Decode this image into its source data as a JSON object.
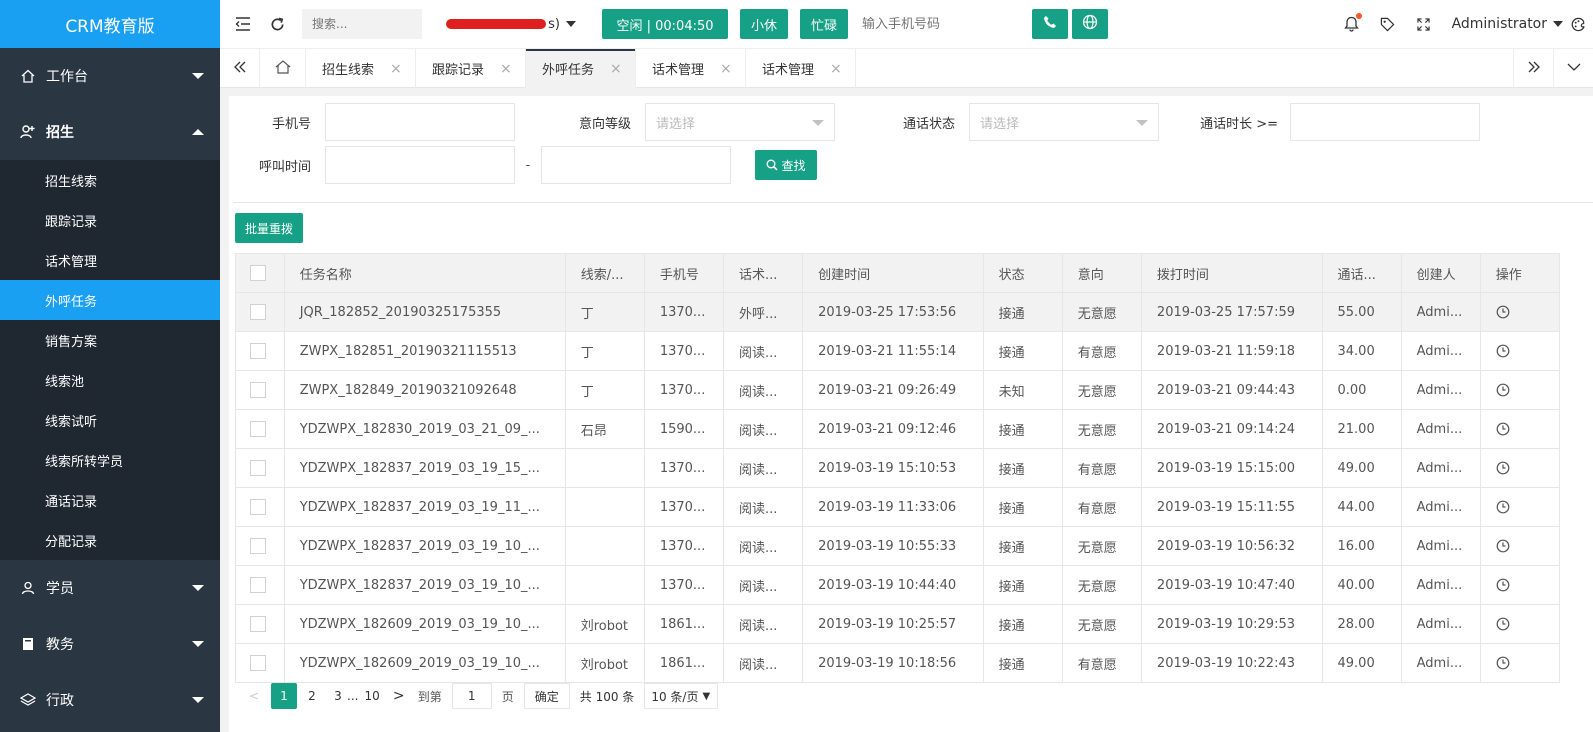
{
  "app": {
    "title": "CRM教育版"
  },
  "sidebar": {
    "items": [
      {
        "label": "工作台"
      },
      {
        "label": "招生"
      },
      {
        "label": "学员"
      },
      {
        "label": "教务"
      },
      {
        "label": "行政"
      }
    ],
    "sub_items": [
      {
        "label": "招生线索"
      },
      {
        "label": "跟踪记录"
      },
      {
        "label": "话术管理"
      },
      {
        "label": "外呼任务"
      },
      {
        "label": "销售方案"
      },
      {
        "label": "线索池"
      },
      {
        "label": "线索试听"
      },
      {
        "label": "线索所转学员"
      },
      {
        "label": "通话记录"
      },
      {
        "label": "分配记录"
      }
    ]
  },
  "topbar": {
    "search_placeholder": "搜索...",
    "redacted_tail": "s)",
    "status_label": "空闲 | 00:04:50",
    "rest_label": "小休",
    "busy_label": "忙碌",
    "phone_placeholder": "输入手机号码",
    "user_name": "Administrator"
  },
  "tabs": [
    {
      "label": "招生线索"
    },
    {
      "label": "跟踪记录"
    },
    {
      "label": "外呼任务"
    },
    {
      "label": "话术管理"
    },
    {
      "label": "话术管理"
    }
  ],
  "filters": {
    "phone_label": "手机号",
    "intent_label": "意向等级",
    "intent_placeholder": "请选择",
    "call_status_label": "通话状态",
    "call_status_placeholder": "请选择",
    "duration_label": "通话时长 >=",
    "call_time_label": "呼叫时间",
    "range_sep": "-",
    "search_button": "查找"
  },
  "batch_redial_button": "批量重拨",
  "table": {
    "headers": [
      "任务名称",
      "线索/...",
      "手机号",
      "话术...",
      "创建时间",
      "状态",
      "意向",
      "拨打时间",
      "通话...",
      "创建人",
      "操作"
    ],
    "rows": [
      [
        "JQR_182852_20190325175355",
        "丁",
        "1370...",
        "外呼...",
        "2019-03-25 17:53:56",
        "接通",
        "无意愿",
        "2019-03-25 17:57:59",
        "55.00",
        "Admi..."
      ],
      [
        "ZWPX_182851_20190321115513",
        "丁",
        "1370...",
        "阅读...",
        "2019-03-21 11:55:14",
        "接通",
        "有意愿",
        "2019-03-21 11:59:18",
        "34.00",
        "Admi..."
      ],
      [
        "ZWPX_182849_20190321092648",
        "丁",
        "1370...",
        "阅读...",
        "2019-03-21 09:26:49",
        "未知",
        "无意愿",
        "2019-03-21 09:44:43",
        "0.00",
        "Admi..."
      ],
      [
        "YDZWPX_182830_2019_03_21_09_...",
        "石昂",
        "1590...",
        "阅读...",
        "2019-03-21 09:12:46",
        "接通",
        "无意愿",
        "2019-03-21 09:14:24",
        "21.00",
        "Admi..."
      ],
      [
        "YDZWPX_182837_2019_03_19_15_...",
        "",
        "1370...",
        "阅读...",
        "2019-03-19 15:10:53",
        "接通",
        "有意愿",
        "2019-03-19 15:15:00",
        "49.00",
        "Admi..."
      ],
      [
        "YDZWPX_182837_2019_03_19_11_...",
        "",
        "1370...",
        "阅读...",
        "2019-03-19 11:33:06",
        "接通",
        "有意愿",
        "2019-03-19 15:11:55",
        "44.00",
        "Admi..."
      ],
      [
        "YDZWPX_182837_2019_03_19_10_...",
        "",
        "1370...",
        "阅读...",
        "2019-03-19 10:55:33",
        "接通",
        "无意愿",
        "2019-03-19 10:56:32",
        "16.00",
        "Admi..."
      ],
      [
        "YDZWPX_182837_2019_03_19_10_...",
        "",
        "1370...",
        "阅读...",
        "2019-03-19 10:44:40",
        "接通",
        "无意愿",
        "2019-03-19 10:47:40",
        "40.00",
        "Admi..."
      ],
      [
        "YDZWPX_182609_2019_03_19_10_...",
        "刘robot",
        "1861...",
        "阅读...",
        "2019-03-19 10:25:57",
        "接通",
        "无意愿",
        "2019-03-19 10:29:53",
        "28.00",
        "Admi..."
      ],
      [
        "YDZWPX_182609_2019_03_19_10_...",
        "刘robot",
        "1861...",
        "阅读...",
        "2019-03-19 10:18:56",
        "接通",
        "有意愿",
        "2019-03-19 10:22:43",
        "49.00",
        "Admi..."
      ]
    ]
  },
  "pagination": {
    "prev": "<",
    "pages": [
      "1",
      "2",
      "3"
    ],
    "ellipsis": "...",
    "last_page": "10",
    "next": ">",
    "goto_label": "到第",
    "goto_value": "1",
    "page_unit": "页",
    "confirm": "确定",
    "total": "共 100 条",
    "page_size": "10 条/页"
  },
  "colors": {
    "sidebar_bg": "#2b3643",
    "accent_blue": "#1aa0f2",
    "accent_green": "#16a085"
  },
  "icons": [
    "menu-fold-icon",
    "refresh-icon",
    "home-icon",
    "phone-icon",
    "globe-icon",
    "bell-icon",
    "tag-icon",
    "fullscreen-icon",
    "theme-icon",
    "clock-icon"
  ]
}
